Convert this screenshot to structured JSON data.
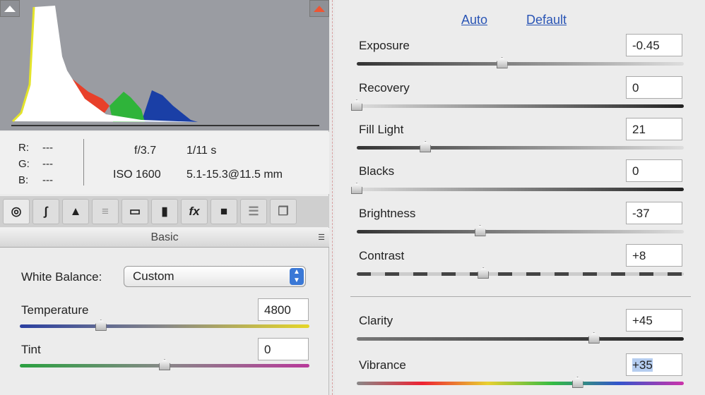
{
  "histogram": {
    "shadow_clip": "shadow-clipping-toggle",
    "highlight_clip": "highlight-clipping-toggle"
  },
  "info": {
    "r_label": "R:",
    "g_label": "G:",
    "b_label": "B:",
    "r": "---",
    "g": "---",
    "b": "---",
    "aperture": "f/3.7",
    "shutter": "1/11 s",
    "iso": "ISO 1600",
    "lens": "5.1-15.3@11.5 mm"
  },
  "tools": [
    "basic",
    "tone-curve",
    "detail",
    "hsl",
    "split-toning",
    "lens-corrections",
    "effects",
    "camera-calibration",
    "presets",
    "snapshots"
  ],
  "panel_title": "Basic",
  "white_balance": {
    "label": "White Balance:",
    "value": "Custom"
  },
  "left_sliders": [
    {
      "label": "Temperature",
      "value": "4800",
      "fraction": 0.28
    },
    {
      "label": "Tint",
      "value": "0",
      "fraction": 0.5
    }
  ],
  "links": {
    "auto": "Auto",
    "default": "Default"
  },
  "right_sliders": [
    {
      "label": "Exposure",
      "value": "-0.45",
      "fraction": 0.444
    },
    {
      "label": "Recovery",
      "value": "0",
      "fraction": 0
    },
    {
      "label": "Fill Light",
      "value": "21",
      "fraction": 0.21
    },
    {
      "label": "Blacks",
      "value": "0",
      "fraction": 0
    },
    {
      "label": "Brightness",
      "value": "-37",
      "fraction": 0.377
    },
    {
      "label": "Contrast",
      "value": "+8",
      "fraction": 0.387
    },
    {
      "label": "Clarity",
      "value": "+45",
      "fraction": 0.725
    },
    {
      "label": "Vibrance",
      "value": "+35",
      "fraction": 0.675
    }
  ]
}
